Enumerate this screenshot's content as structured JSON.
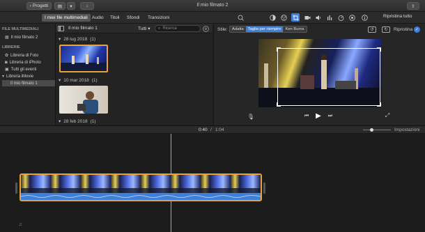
{
  "window": {
    "title": "Il mio filmato 2",
    "back_label": "Progetti",
    "share_icon": "share-icon"
  },
  "tabs": [
    {
      "label": "I miei file multimediali",
      "active": true
    },
    {
      "label": "Audio",
      "active": false
    },
    {
      "label": "Titoli",
      "active": false
    },
    {
      "label": "Sfondi",
      "active": false
    },
    {
      "label": "Transizioni",
      "active": false
    }
  ],
  "sidebar": {
    "section1": "FILE MULTIMEDIALI",
    "item_project": "Il mio filmato 2",
    "section2": "LIBRERIE",
    "items": [
      "Libreria di Foto",
      "Libreria di iPhoto",
      "Tutti gli eventi"
    ],
    "library": "Libreria iMovie",
    "library_item": "Il mio filmato 1"
  },
  "browser": {
    "current": "Il mio filmato 1",
    "filter": "Tutti",
    "search_placeholder": "Ricerca",
    "events": [
      {
        "date": "28 lug 2018",
        "count": "(1)"
      },
      {
        "date": "10 mar 2018",
        "count": "(1)"
      },
      {
        "date": "28 feb 2018",
        "count": "(1)"
      }
    ]
  },
  "viewer": {
    "reset_label": "Ripristina tutto",
    "style_label": "Stile:",
    "style_options": [
      "Adatta",
      "Taglia per riempire",
      "Ken Burns"
    ],
    "selected_style": "Taglia per riempire",
    "restore_label": "Ripristina"
  },
  "timeline": {
    "current_time": "0:40",
    "separator": "/",
    "total_time": "1:04",
    "settings_label": "Impostazioni"
  },
  "colors": {
    "accent": "#3d7fd9",
    "selection": "#e8a33d"
  }
}
